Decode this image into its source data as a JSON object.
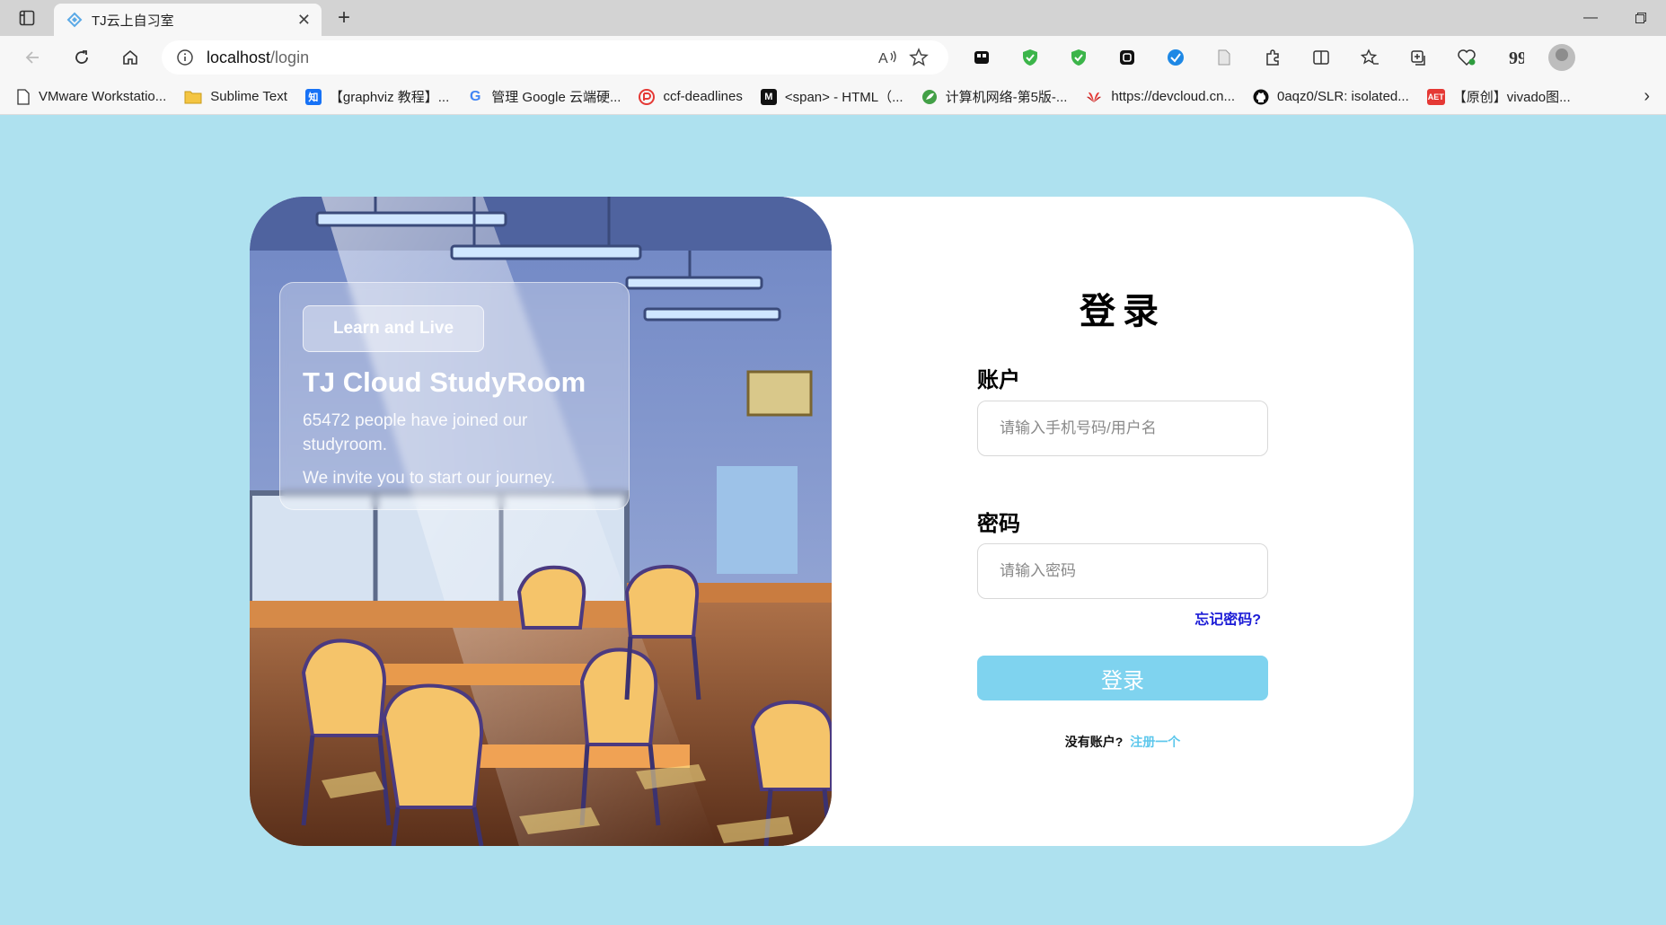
{
  "browser": {
    "tab_title": "TJ云上自习室",
    "url_host": "localhost",
    "url_path": "/login",
    "bookmarks": [
      "VMware Workstatio...",
      "Sublime Text",
      "【graphviz 教程】...",
      "管理 Google 云端硬...",
      "ccf-deadlines",
      "<span> - HTML（...",
      "计算机网络-第5版-...",
      "https://devcloud.cn...",
      "0aqz0/SLR: isolated...",
      "【原创】vivado图..."
    ],
    "bookmark_icon_text": {
      "zhihu": "知",
      "google": "G",
      "mdn": "M",
      "csdn": "AET"
    }
  },
  "hero": {
    "pill": "Learn and Live",
    "title": "TJ Cloud StudyRoom",
    "text": "65472 people have joined our studyroom.",
    "text2": "We invite you to start our journey."
  },
  "login": {
    "title": "登录",
    "account_label": "账户",
    "account_placeholder": "请输入手机号码/用户名",
    "password_label": "密码",
    "password_placeholder": "请输入密码",
    "forgot": "忘记密码?",
    "submit": "登录",
    "no_account": "没有账户?",
    "register": "注册一个"
  },
  "colors": {
    "page_bg": "#aee1ef",
    "button": "#7fd3ef",
    "forgot_link": "#1b1bd6",
    "register_link": "#5cc7ec"
  }
}
